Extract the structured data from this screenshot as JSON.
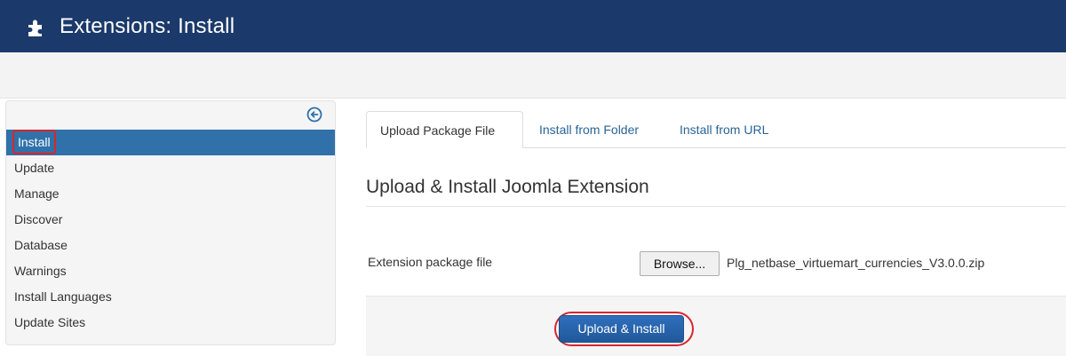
{
  "header": {
    "title": "Extensions: Install",
    "icon": "puzzle-icon",
    "background": "#1b3a6b"
  },
  "sidebar": {
    "collapse_icon": "arrow-circle-left-icon",
    "items": [
      {
        "label": "Install",
        "active": true
      },
      {
        "label": "Update",
        "active": false
      },
      {
        "label": "Manage",
        "active": false
      },
      {
        "label": "Discover",
        "active": false
      },
      {
        "label": "Database",
        "active": false
      },
      {
        "label": "Warnings",
        "active": false
      },
      {
        "label": "Install Languages",
        "active": false
      },
      {
        "label": "Update Sites",
        "active": false
      }
    ]
  },
  "tabs": [
    {
      "label": "Upload Package File",
      "active": true
    },
    {
      "label": "Install from Folder",
      "active": false
    },
    {
      "label": "Install from URL",
      "active": false
    }
  ],
  "main": {
    "section_title": "Upload & Install Joomla Extension",
    "field_label": "Extension package file",
    "browse_label": "Browse...",
    "file_name": "Plg_netbase_virtuemart_currencies_V3.0.0.zip",
    "submit_label": "Upload & Install"
  },
  "colors": {
    "accent": "#3071a9",
    "highlight": "#d9262b",
    "link": "#2a6496"
  }
}
